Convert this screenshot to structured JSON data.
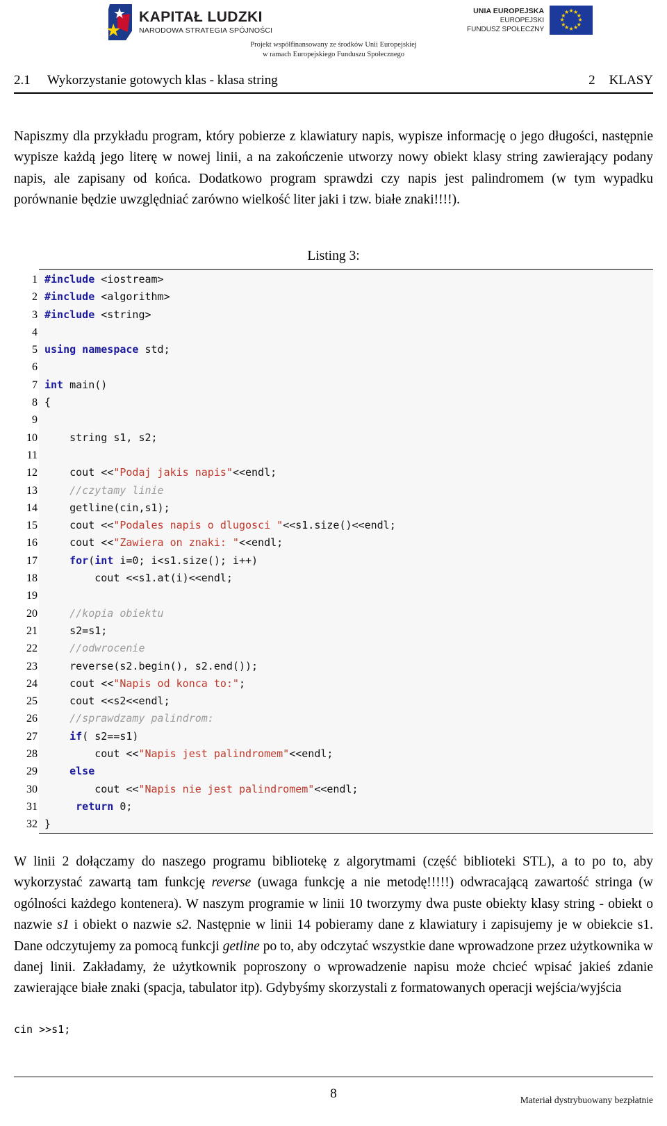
{
  "banner": {
    "kl_logo_title": "KAPITAŁ LUDZKI",
    "kl_logo_subtitle": "NARODOWA STRATEGIA SPÓJNOŚCI",
    "eu_line1": "UNIA EUROPEJSKA",
    "eu_line2": "EUROPEJSKI",
    "eu_line3": "FUNDUSZ SPOŁECZNY",
    "caption_line1": "Projekt współfinansowany ze środków Unii Europejskiej",
    "caption_line2": "w ramach Europejskiego Funduszu Społecznego"
  },
  "running_head": {
    "section_number": "2.1",
    "section_title": "Wykorzystanie gotowych klas - klasa string",
    "chapter_number": "2",
    "chapter_title": "KLASY"
  },
  "intro": {
    "text": "Napiszmy dla przykładu program, który pobierze z klawiatury napis, wypisze informację o jego długości, następnie wypisze każdą jego literę w nowej linii, a na zakończenie utworzy nowy obiekt klasy string zawierający podany napis, ale zapisany od końca. Dodatkowo program sprawdzi czy napis jest palindromem (w tym wypadku porównanie będzie uwzględniać zarówno wielkość liter jaki i tzw. białe znaki!!!!)."
  },
  "listing": {
    "caption": "Listing 3:",
    "lines": [
      {
        "n": "1",
        "tokens": [
          {
            "t": "pre",
            "s": "#include"
          },
          {
            "t": "pln",
            "s": " <iostream>"
          }
        ]
      },
      {
        "n": "2",
        "tokens": [
          {
            "t": "pre",
            "s": "#include"
          },
          {
            "t": "pln",
            "s": " <algorithm>"
          }
        ]
      },
      {
        "n": "3",
        "tokens": [
          {
            "t": "pre",
            "s": "#include"
          },
          {
            "t": "pln",
            "s": " <string>"
          }
        ]
      },
      {
        "n": "4",
        "tokens": []
      },
      {
        "n": "5",
        "tokens": [
          {
            "t": "kw",
            "s": "using namespace"
          },
          {
            "t": "pln",
            "s": " std;"
          }
        ]
      },
      {
        "n": "6",
        "tokens": []
      },
      {
        "n": "7",
        "tokens": [
          {
            "t": "kw",
            "s": "int"
          },
          {
            "t": "pln",
            "s": " main()"
          }
        ]
      },
      {
        "n": "8",
        "tokens": [
          {
            "t": "pln",
            "s": "{"
          }
        ]
      },
      {
        "n": "9",
        "tokens": []
      },
      {
        "n": "10",
        "tokens": [
          {
            "t": "pln",
            "s": "    string s1, s2;"
          }
        ]
      },
      {
        "n": "11",
        "tokens": []
      },
      {
        "n": "12",
        "tokens": [
          {
            "t": "pln",
            "s": "    cout <<"
          },
          {
            "t": "str",
            "s": "\"Podaj jakis napis\""
          },
          {
            "t": "pln",
            "s": "<<endl;"
          }
        ]
      },
      {
        "n": "13",
        "tokens": [
          {
            "t": "pln",
            "s": "    "
          },
          {
            "t": "cmt",
            "s": "//czytamy linie"
          }
        ]
      },
      {
        "n": "14",
        "tokens": [
          {
            "t": "pln",
            "s": "    getline(cin,s1);"
          }
        ]
      },
      {
        "n": "15",
        "tokens": [
          {
            "t": "pln",
            "s": "    cout <<"
          },
          {
            "t": "str",
            "s": "\"Podales napis o dlugosci \""
          },
          {
            "t": "pln",
            "s": "<<s1.size()<<endl;"
          }
        ]
      },
      {
        "n": "16",
        "tokens": [
          {
            "t": "pln",
            "s": "    cout <<"
          },
          {
            "t": "str",
            "s": "\"Zawiera on znaki: \""
          },
          {
            "t": "pln",
            "s": "<<endl;"
          }
        ]
      },
      {
        "n": "17",
        "tokens": [
          {
            "t": "pln",
            "s": "    "
          },
          {
            "t": "kw",
            "s": "for"
          },
          {
            "t": "pln",
            "s": "("
          },
          {
            "t": "kw",
            "s": "int"
          },
          {
            "t": "pln",
            "s": " i=0; i<s1.size(); i++)"
          }
        ]
      },
      {
        "n": "18",
        "tokens": [
          {
            "t": "pln",
            "s": "        cout <<s1.at(i)<<endl;"
          }
        ]
      },
      {
        "n": "19",
        "tokens": []
      },
      {
        "n": "20",
        "tokens": [
          {
            "t": "pln",
            "s": "    "
          },
          {
            "t": "cmt",
            "s": "//kopia obiektu"
          }
        ]
      },
      {
        "n": "21",
        "tokens": [
          {
            "t": "pln",
            "s": "    s2=s1;"
          }
        ]
      },
      {
        "n": "22",
        "tokens": [
          {
            "t": "pln",
            "s": "    "
          },
          {
            "t": "cmt",
            "s": "//odwrocenie"
          }
        ]
      },
      {
        "n": "23",
        "tokens": [
          {
            "t": "pln",
            "s": "    reverse(s2.begin(), s2.end());"
          }
        ]
      },
      {
        "n": "24",
        "tokens": [
          {
            "t": "pln",
            "s": "    cout <<"
          },
          {
            "t": "str",
            "s": "\"Napis od konca to:\""
          },
          {
            "t": "pln",
            "s": ";"
          }
        ]
      },
      {
        "n": "25",
        "tokens": [
          {
            "t": "pln",
            "s": "    cout <<s2<<endl;"
          }
        ]
      },
      {
        "n": "26",
        "tokens": [
          {
            "t": "pln",
            "s": "    "
          },
          {
            "t": "cmt",
            "s": "//sprawdzamy palindrom:"
          }
        ]
      },
      {
        "n": "27",
        "tokens": [
          {
            "t": "pln",
            "s": "    "
          },
          {
            "t": "kw",
            "s": "if"
          },
          {
            "t": "pln",
            "s": "( s2==s1)"
          }
        ]
      },
      {
        "n": "28",
        "tokens": [
          {
            "t": "pln",
            "s": "        cout <<"
          },
          {
            "t": "str",
            "s": "\"Napis jest palindromem\""
          },
          {
            "t": "pln",
            "s": "<<endl;"
          }
        ]
      },
      {
        "n": "29",
        "tokens": [
          {
            "t": "pln",
            "s": "    "
          },
          {
            "t": "kw",
            "s": "else"
          }
        ]
      },
      {
        "n": "30",
        "tokens": [
          {
            "t": "pln",
            "s": "        cout <<"
          },
          {
            "t": "str",
            "s": "\"Napis nie jest palindromem\""
          },
          {
            "t": "pln",
            "s": "<<endl;"
          }
        ]
      },
      {
        "n": "31",
        "tokens": [
          {
            "t": "pln",
            "s": "     "
          },
          {
            "t": "kw",
            "s": "return"
          },
          {
            "t": "pln",
            "s": " 0;"
          }
        ]
      },
      {
        "n": "32",
        "tokens": [
          {
            "t": "pln",
            "s": "}"
          }
        ]
      }
    ]
  },
  "outro": {
    "seg1": "W linii 2 dołączamy do naszego programu bibliotekę z algorytmami (część biblioteki STL), a to po to, aby wykorzystać zawartą tam funkcję ",
    "em1": "reverse",
    "seg2": " (uwaga funkcję a nie metodę!!!!!) odwracającą zawartość stringa (w ogólności każdego kontenera). W naszym programie w linii 10 tworzymy dwa puste obiekty klasy string - obiekt o nazwie ",
    "em2": "s1",
    "seg3": " i obiekt o nazwie ",
    "em3": "s2",
    "seg4": ". Następnie w linii 14 pobieramy dane z klawiatury i zapisujemy je w obiekcie s1. Dane odczytujemy za pomocą funkcji ",
    "em4": "getline",
    "seg5": " po to, aby odczytać wszystkie dane wprowadzone przez użytkownika w danej linii. Zakładamy, że użytkownik poproszony o wprowadzenie napisu może chcieć wpisać jakieś zdanie zawierające białe znaki (spacja, tabulator itp). Gdybyśmy skorzystali z formatowanych operacji wejścia/wyjścia",
    "code_inline": "cin >>s1;"
  },
  "footer": {
    "page_number": "8",
    "note": "Materiał dystrybuowany bezpłatnie"
  },
  "colors": {
    "keyword": "#1b1b9e",
    "string": "#c0392b",
    "comment": "#9b9b9b",
    "listing_background": "#f7f7f7",
    "eu_blue": "#1c3a9c",
    "eu_star_yellow": "#ffd400"
  }
}
